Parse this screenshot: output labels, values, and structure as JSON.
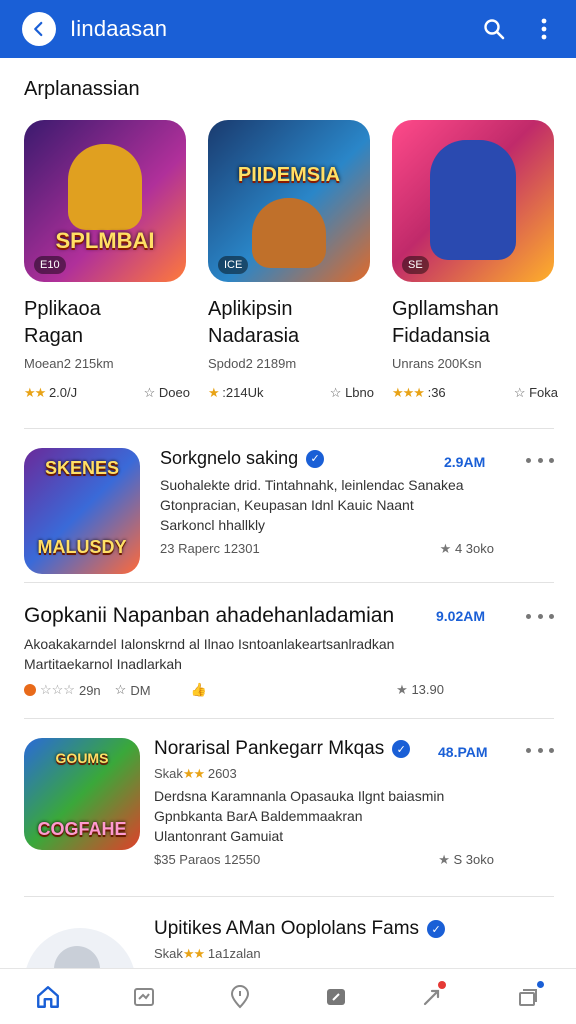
{
  "appbar": {
    "title": "Iindaasan",
    "back_icon": "back-arrow-icon",
    "search_icon": "search-icon",
    "more_icon": "more-vert-icon",
    "color": "#1a5fd6"
  },
  "section": {
    "title": "Arplanassian"
  },
  "featured": [
    {
      "thumb_text": "SPLMBAI",
      "chip": "E10",
      "name_line1": "Pplikaoa",
      "name_line2": "Ragan",
      "sub": "Moean2 215km",
      "stars": "★★",
      "rating": "2.0/J",
      "install_label": "Doeo",
      "bg": "linear-gradient(135deg,#3a1a6e,#b0309a 60%,#ff7a3a)",
      "figure": "#e0a020"
    },
    {
      "thumb_text": "PIIDEMSIA",
      "chip": "ICE",
      "name_line1": "Aplikipsin",
      "name_line2": "Nadarasia",
      "sub": "Spdod2 2189m",
      "stars": "★",
      "rating": ":214Uk",
      "install_label": "Lbno",
      "bg": "linear-gradient(135deg,#1a3a6e,#2a86c8 55%,#e06a2a)",
      "figure": "#c0702a"
    },
    {
      "thumb_text": "",
      "chip": "SE",
      "name_line1": "Gpllamshan",
      "name_line2": "Fidadansia",
      "sub": "Unrans 200Ksn",
      "stars": "★★★",
      "rating": ":36",
      "install_label": "Foka",
      "bg": "linear-gradient(135deg,#ff4a8a,#c02a6a 45%,#ffb02a)",
      "figure": "#2a4ab0"
    }
  ],
  "list": [
    {
      "thumb_text": "MALUSDY",
      "thumb_top_text": "SKENES",
      "title": "Sorkgnelo saking",
      "size": "2.9AM",
      "desc1": "Suohalekte drid. Tintahnahk, leinlendac Sanakea",
      "desc2": "Gtonpracian, Keupasan Idnl Kauic Naant",
      "desc3": "Sarkoncl hhallkly",
      "meta_left": "23 Raperc 12301",
      "meta_right": "4 3oko",
      "bg": "linear-gradient(135deg,#6a2a9a,#3a6ad8 50%,#ff6a3a)"
    },
    {
      "title": "Gopkanii Napanban ahadehanladamian",
      "size": "9.02AM",
      "desc1": "Akoakakarndel Ialonskrnd al Ilnao Isntoanlakeartsanlradkan",
      "desc2": "Martitaekarnol Inadlarkah",
      "stars_left": "☆☆☆",
      "meta_left": "29n",
      "meta_mid": "DM",
      "meta_right": "13.90"
    },
    {
      "thumb_text": "COGFAHE",
      "thumb_top_text": "GOUMS",
      "title": "Norarisal Pankegarr Mkqas",
      "size": "48.PAM",
      "sub": "Skak",
      "sub_rating": "2603",
      "sub_stars": "★★",
      "desc1": "Derdsna Karamnanla Opasauka Ilgnt baiasmin",
      "desc2": "Gpnbkanta BarA Baldemmaakran",
      "desc3": "Ulantonrant Gamuiat",
      "meta_left": "$35 Paraos 12550",
      "meta_right": "S 3oko",
      "bg": "linear-gradient(135deg,#2a6ad8,#3aa83a 50%,#e0402a)"
    },
    {
      "title": "Upitikes AMan Ooplolans Fams",
      "sub": "Skak",
      "sub_stars": "★★",
      "sub_rating": "1a1zalan"
    }
  ],
  "bottomnav": [
    {
      "name": "home-icon",
      "active": true
    },
    {
      "name": "apps-icon"
    },
    {
      "name": "location-icon"
    },
    {
      "name": "games-icon"
    },
    {
      "name": "rocket-icon",
      "badge": true
    },
    {
      "name": "library-icon"
    }
  ]
}
